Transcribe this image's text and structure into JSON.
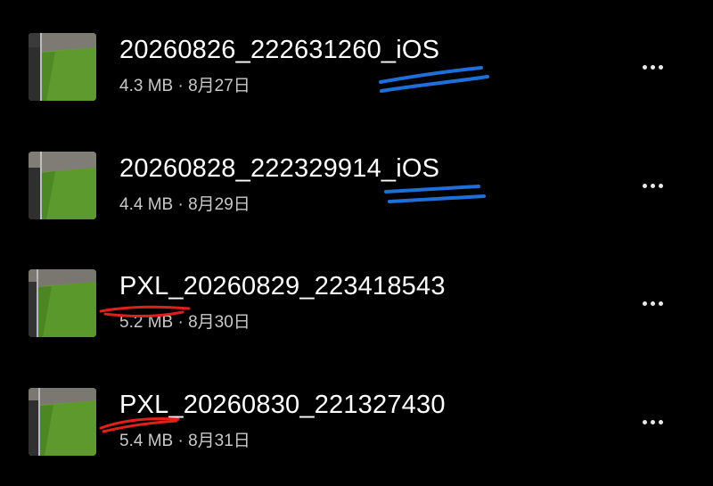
{
  "files": [
    {
      "name": "20260826_222631260_iOS",
      "size": "4.3 MB",
      "separator": "·",
      "date": "8月27日"
    },
    {
      "name": "20260828_222329914_iOS",
      "size": "4.4 MB",
      "separator": "·",
      "date": "8月29日"
    },
    {
      "name": "PXL_20260829_223418543",
      "size": "5.2 MB",
      "separator": "·",
      "date": "8月30日"
    },
    {
      "name": "PXL_20260830_221327430",
      "size": "5.4 MB",
      "separator": "·",
      "date": "8月31日"
    }
  ],
  "icons": {
    "thumbnail": "image-thumbnail-icon",
    "more": "more-options-icon"
  },
  "colors": {
    "background": "#000000",
    "title_text": "#ffffff",
    "meta_text": "#c9c9c9",
    "annotation_blue": "#1e6fd9",
    "annotation_red": "#e0201c"
  }
}
